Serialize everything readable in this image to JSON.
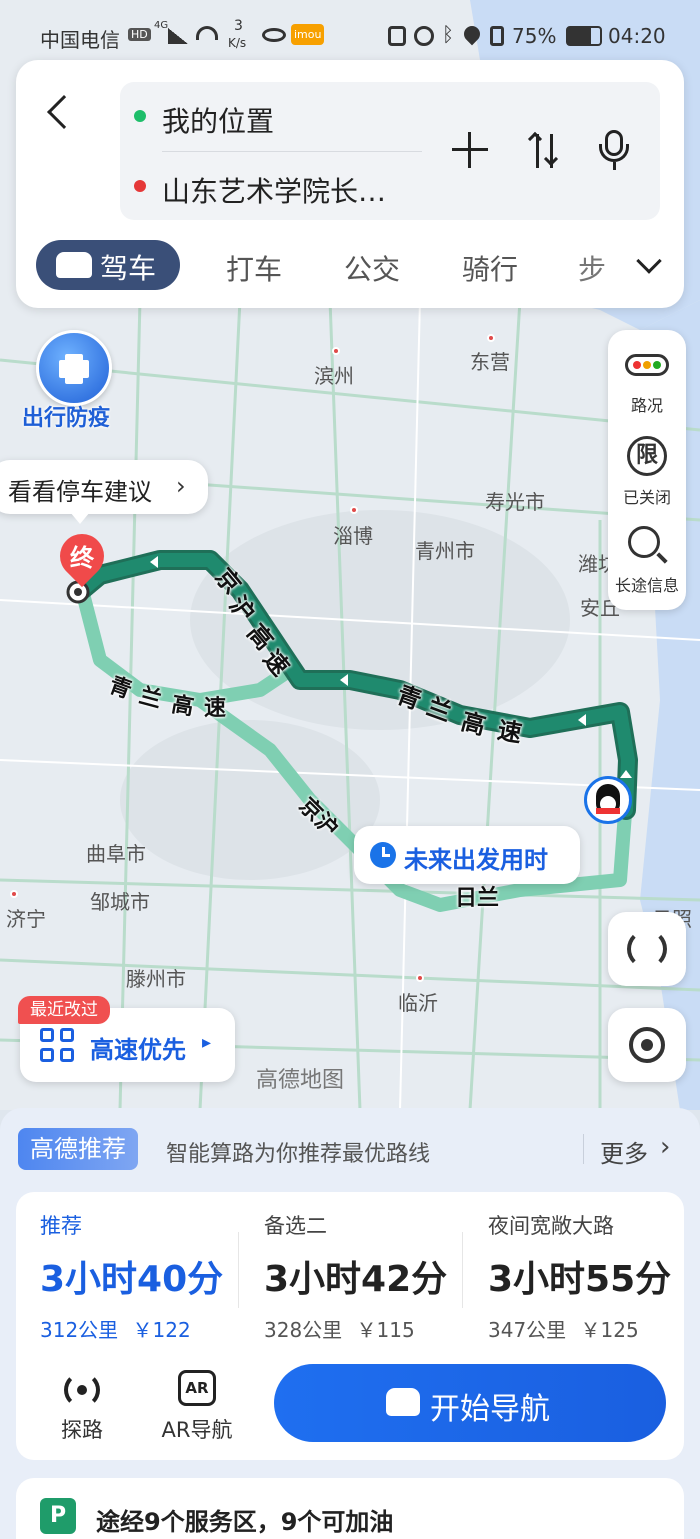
{
  "status_bar": {
    "carrier": "中国电信",
    "hd": "HD",
    "network": "4G",
    "speed_value": "3",
    "speed_unit": "K/s",
    "app_badge": "imou",
    "battery": "75%",
    "time": "04:20"
  },
  "search": {
    "origin": "我的位置",
    "destination": "山东艺术学院长…"
  },
  "modes": [
    {
      "label": "驾车",
      "active": true
    },
    {
      "label": "打车"
    },
    {
      "label": "公交"
    },
    {
      "label": "骑行"
    },
    {
      "label": "步"
    }
  ],
  "map": {
    "epidemic_label": "出行防疫",
    "parking_tip": "看看停车建议",
    "end_marker": "终",
    "future_departure": "未来出发用时",
    "watermark": "高德地图",
    "cities": [
      "滨州",
      "东营",
      "寿光市",
      "淄博",
      "青州市",
      "潍坊",
      "安丘",
      "曲阜市",
      "邹城市",
      "济宁",
      "滕州市",
      "临沂",
      "日照"
    ],
    "road_labels": {
      "jinghu": [
        "京",
        "沪",
        "高",
        "速"
      ],
      "qinglan_right": [
        "青",
        "兰",
        "高",
        "速"
      ],
      "qinglan_left": [
        "青",
        "兰",
        "高",
        "速"
      ],
      "jinghu_lower": "京沪",
      "rilan_lower": "日兰"
    },
    "route_color": "#1f8a6e",
    "alt_route_color": "#7fcfb2"
  },
  "side_controls": {
    "traffic": "路况",
    "restriction_icon": "限",
    "restriction": "已关闭",
    "long_trip": "长途信息"
  },
  "preference": {
    "badge": "最近改过",
    "label": "高速优先"
  },
  "recommend_bar": {
    "badge": "高德推荐",
    "text": "智能算路为你推荐最优路线",
    "more": "更多"
  },
  "routes": [
    {
      "tag": "推荐",
      "duration": "3小时40分",
      "distance": "312公里",
      "cost": "￥122",
      "selected": true
    },
    {
      "tag": "备选二",
      "duration": "3小时42分",
      "distance": "328公里",
      "cost": "￥115"
    },
    {
      "tag": "夜间宽敞大路",
      "duration": "3小时55分",
      "distance": "347公里",
      "cost": "￥125"
    }
  ],
  "actions": {
    "explore": "探路",
    "ar_icon": "AR",
    "ar_nav": "AR导航",
    "start_nav": "开始导航"
  },
  "service_info": {
    "icon": "P",
    "text": "途经9个服务区，9个可加油"
  },
  "colors": {
    "accent": "#1a73e8",
    "nav_button": "#1a5fe0",
    "selected_tab": "#3a4f78"
  }
}
